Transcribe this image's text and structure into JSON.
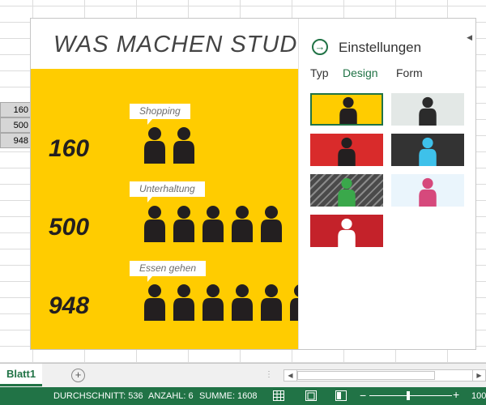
{
  "sheet": {
    "cells": [
      "160",
      "500",
      "948"
    ]
  },
  "addin": {
    "title": "WAS MACHEN STUDE",
    "rows": [
      {
        "value": "160",
        "label": "Shopping",
        "people": 1.9
      },
      {
        "value": "500",
        "label": "Unterhaltung",
        "people": 5
      },
      {
        "value": "948",
        "label": "Essen gehen",
        "people": 6
      }
    ],
    "colors": {
      "background": "#ffcc00",
      "person": "#231f20"
    },
    "settings": {
      "title": "Einstellungen",
      "icon": "arrow-circle-right-icon",
      "tabs": [
        {
          "label": "Typ",
          "active": false
        },
        {
          "label": "Design",
          "active": true
        },
        {
          "label": "Form",
          "active": false
        }
      ],
      "swatches": [
        {
          "bg": "#ffcc00",
          "person": "#231f20",
          "selected": true
        },
        {
          "bg": "#e3e8e6",
          "person": "#2b2b2b",
          "selected": false
        },
        {
          "bg": "#d92b2b",
          "person": "#231f20",
          "selected": false
        },
        {
          "bg": "#333333",
          "person": "#3ec1ea",
          "selected": false
        },
        {
          "bg": "#4a4a4a",
          "person": "#3aa84b",
          "striped": true,
          "selected": false
        },
        {
          "bg": "#eaf5fc",
          "person": "#d6497c",
          "selected": false
        },
        {
          "bg": "#c4222a",
          "person": "#ffffff",
          "selected": false
        }
      ]
    }
  },
  "sheetbar": {
    "tab": "Blatt1",
    "add_icon": "plus-circle-icon"
  },
  "status": {
    "average": "DURCHSCHNITT: 536",
    "count": "ANZAHL: 6",
    "sum": "SUMME: 1608",
    "zoom_minus": "−",
    "zoom_plus": "+",
    "zoom": "100"
  }
}
